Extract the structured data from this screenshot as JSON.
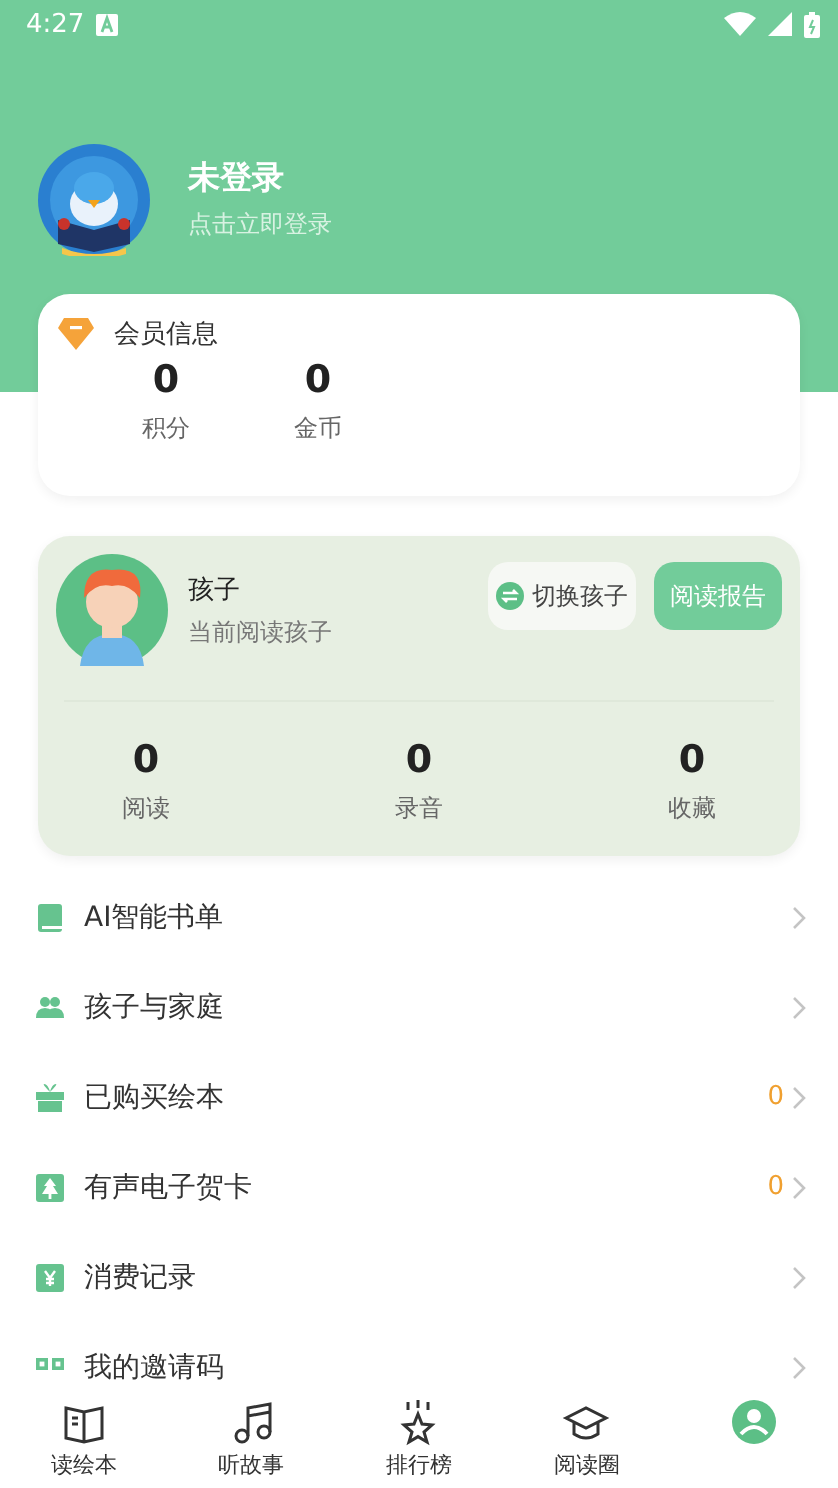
{
  "status_bar": {
    "time": "4:27"
  },
  "profile": {
    "name": "未登录",
    "subtitle": "点击立即登录"
  },
  "membership": {
    "title": "会员信息",
    "stats": [
      {
        "value": "0",
        "label": "积分"
      },
      {
        "value": "0",
        "label": "金币"
      }
    ]
  },
  "child": {
    "name": "孩子",
    "subtitle": "当前阅读孩子",
    "switch_button": "切换孩子",
    "report_button": "阅读报告",
    "stats": [
      {
        "value": "0",
        "label": "阅读"
      },
      {
        "value": "0",
        "label": "录音"
      },
      {
        "value": "0",
        "label": "收藏"
      }
    ]
  },
  "menu": [
    {
      "kind": "book",
      "label": "AI智能书单"
    },
    {
      "kind": "people",
      "label": "孩子与家庭"
    },
    {
      "kind": "gift",
      "label": "已购买绘本",
      "count": "0"
    },
    {
      "kind": "tree",
      "label": "有声电子贺卡",
      "count": "0"
    },
    {
      "kind": "yen",
      "label": "消费记录"
    },
    {
      "kind": "qr",
      "label": "我的邀请码"
    }
  ],
  "bottom_nav": [
    {
      "kind": "book",
      "label": "读绘本",
      "selected": false
    },
    {
      "kind": "music",
      "label": "听故事",
      "selected": false
    },
    {
      "kind": "star",
      "label": "排行榜",
      "selected": false
    },
    {
      "kind": "cap",
      "label": "阅读圈",
      "selected": false
    },
    {
      "kind": "person",
      "selected": true
    }
  ]
}
